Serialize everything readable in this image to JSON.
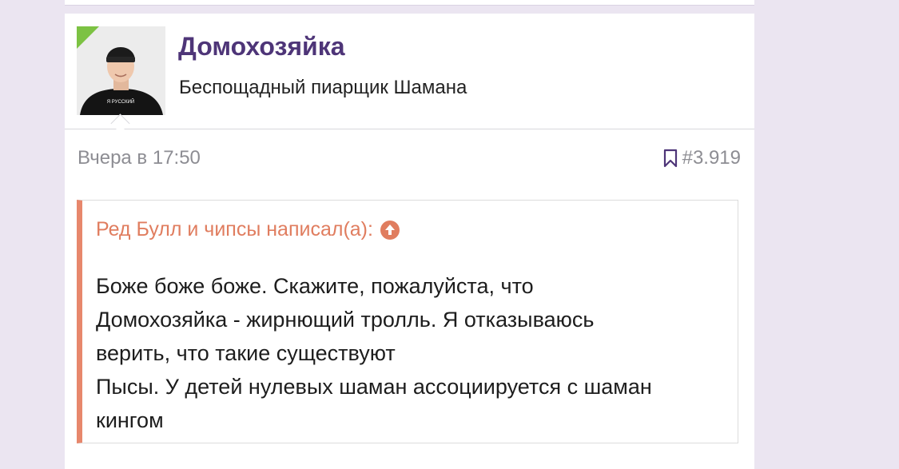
{
  "post": {
    "author": {
      "name": "Домохозяйка",
      "title": "Беспощадный пиарщик Шамана",
      "avatar_shirt_text": "Я РУССКИЙ",
      "online_indicator_color": "#7cc243"
    },
    "date": "Вчера в 17:50",
    "bookmark_icon": "bookmark-icon",
    "post_number": "#3.919",
    "quote": {
      "author_line": "Ред Булл и чипсы написал(а):",
      "jump_icon": "arrow-up-circle-icon",
      "lines": [
        "Боже боже боже. Скажите, пожалуйста, что",
        "Домохозяйка - жирнющий тролль. Я отказываюсь",
        "верить, что такие существуют",
        "Пысы. У детей нулевых шаман ассоциируется с шаман",
        "кингом"
      ],
      "accent_color": "#e7876c"
    }
  }
}
